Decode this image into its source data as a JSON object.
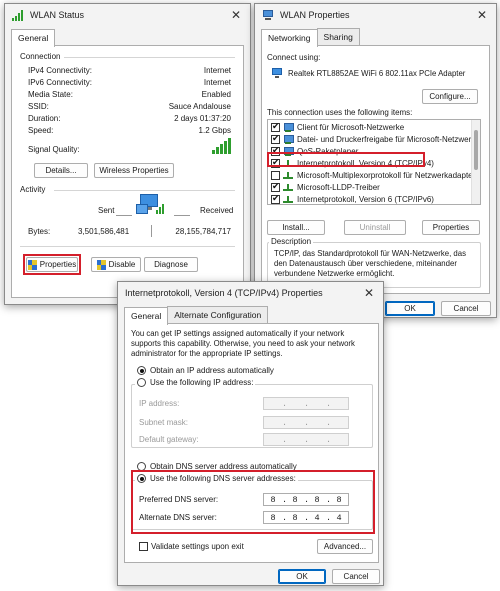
{
  "wlan_status": {
    "title": "WLAN Status",
    "tab": "General",
    "connection_label": "Connection",
    "rows": [
      {
        "label": "IPv4 Connectivity:",
        "value": "Internet"
      },
      {
        "label": "IPv6 Connectivity:",
        "value": "Internet"
      },
      {
        "label": "Media State:",
        "value": "Enabled"
      },
      {
        "label": "SSID:",
        "value": "Sauce Andalouse"
      },
      {
        "label": "Duration:",
        "value": "2 days 01:37:20"
      },
      {
        "label": "Speed:",
        "value": "1.2 Gbps"
      }
    ],
    "signal_quality_label": "Signal Quality:",
    "details_button": "Details...",
    "wireless_props_button": "Wireless Properties",
    "activity_label": "Activity",
    "sent_label": "Sent",
    "received_label": "Received",
    "bytes_label": "Bytes:",
    "bytes_sent": "3,501,586,481",
    "bytes_received": "28,155,784,717",
    "properties_button": "Properties",
    "disable_button": "Disable",
    "diagnose_button": "Diagnose"
  },
  "wlan_properties": {
    "title": "WLAN Properties",
    "tabs": [
      "Networking",
      "Sharing"
    ],
    "connect_using_label": "Connect using:",
    "adapter": "Realtek RTL8852AE WiFi 6 802.11ax PCIe Adapter",
    "configure_button": "Configure...",
    "items_label": "This connection uses the following items:",
    "items": [
      {
        "label": "Client für Microsoft-Netzwerke",
        "checked": true,
        "icon": "network-icon"
      },
      {
        "label": "Datei- und Druckerfreigabe für Microsoft-Netzwerke",
        "checked": true,
        "icon": "network-icon"
      },
      {
        "label": "QoS-Paketplaner",
        "checked": true,
        "icon": "network-icon"
      },
      {
        "label": "Internetprotokoll, Version 4 (TCP/IPv4)",
        "checked": true,
        "icon": "protocol-icon"
      },
      {
        "label": "Microsoft-Multiplexorprotokoll für Netzwerkadapter",
        "checked": false,
        "icon": "protocol-icon"
      },
      {
        "label": "Microsoft-LLDP-Treiber",
        "checked": true,
        "icon": "protocol-icon"
      },
      {
        "label": "Internetprotokoll, Version 6 (TCP/IPv6)",
        "checked": true,
        "icon": "protocol-icon"
      }
    ],
    "install_button": "Install...",
    "uninstall_button": "Uninstall",
    "properties_button": "Properties",
    "description_label": "Description",
    "description_text": "TCP/IP, das Standardprotokoll für WAN-Netzwerke, das den Datenaustausch über verschiedene, miteinander verbundene Netzwerke ermöglicht.",
    "ok_button": "OK",
    "cancel_button": "Cancel"
  },
  "ipv4_properties": {
    "title": "Internetprotokoll, Version 4 (TCP/IPv4) Properties",
    "tabs": [
      "General",
      "Alternate Configuration"
    ],
    "intro_text": "You can get IP settings assigned automatically if your network supports this capability. Otherwise, you need to ask your network administrator for the appropriate IP settings.",
    "obtain_ip_auto": "Obtain an IP address automatically",
    "use_following_ip": "Use the following IP address:",
    "ip_address_label": "IP address:",
    "subnet_mask_label": "Subnet mask:",
    "default_gateway_label": "Default gateway:",
    "obtain_dns_auto": "Obtain DNS server address automatically",
    "use_following_dns": "Use the following DNS server addresses:",
    "preferred_dns_label": "Preferred DNS server:",
    "preferred_dns": [
      "8",
      "8",
      "8",
      "8"
    ],
    "alternate_dns_label": "Alternate DNS server:",
    "alternate_dns": [
      "8",
      "8",
      "4",
      "4"
    ],
    "validate_label": "Validate settings upon exit",
    "advanced_button": "Advanced...",
    "ok_button": "OK",
    "cancel_button": "Cancel"
  },
  "accent_colors": {
    "highlight_box": "#d41f2b",
    "primary_button": "#0067c0",
    "signal": "#2e9e2e"
  }
}
